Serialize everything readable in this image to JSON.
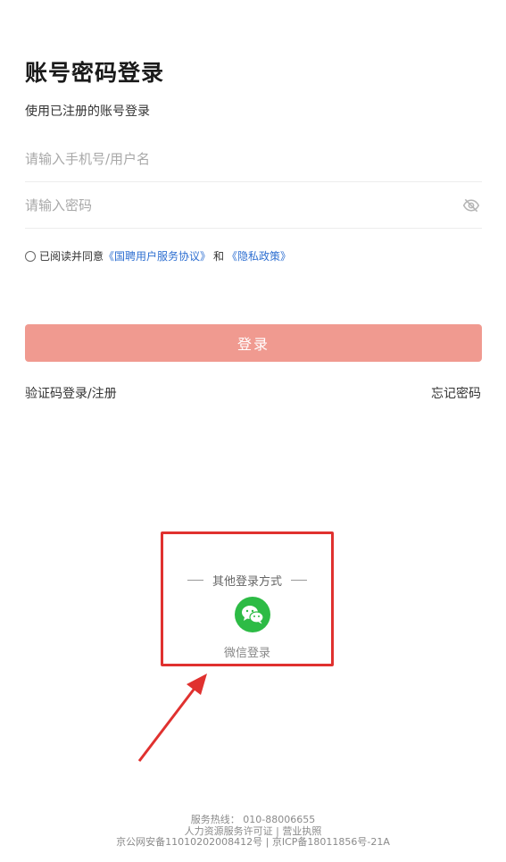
{
  "header": {
    "title": "账号密码登录",
    "subtitle": "使用已注册的账号登录"
  },
  "form": {
    "phone_placeholder": "请输入手机号/用户名",
    "password_placeholder": "请输入密码",
    "password_toggle_icon": "eye-off-icon"
  },
  "agreement": {
    "prefix": "已阅读并同意",
    "service_link": "《国聘用户服务协议》",
    "and": "和",
    "privacy_link": "《隐私政策》"
  },
  "actions": {
    "login_label": "登录",
    "sms_login_label": "验证码登录/注册",
    "forgot_password_label": "忘记密码"
  },
  "other_login": {
    "title": "其他登录方式",
    "wechat_icon": "wechat-icon",
    "wechat_label": "微信登录"
  },
  "footer": {
    "hotline": "服务热线：  010-88006655",
    "license_link": "人力资源服务许可证",
    "separator": "|",
    "business_link": "营业执照",
    "icp": "京公网安备11010202008412号 | 京ICP备18011856号-21A"
  },
  "colors": {
    "primary_button": "#f09a90",
    "link": "#2e6fd1",
    "wechat": "#2dbb45",
    "highlight_box": "#e0312f"
  }
}
